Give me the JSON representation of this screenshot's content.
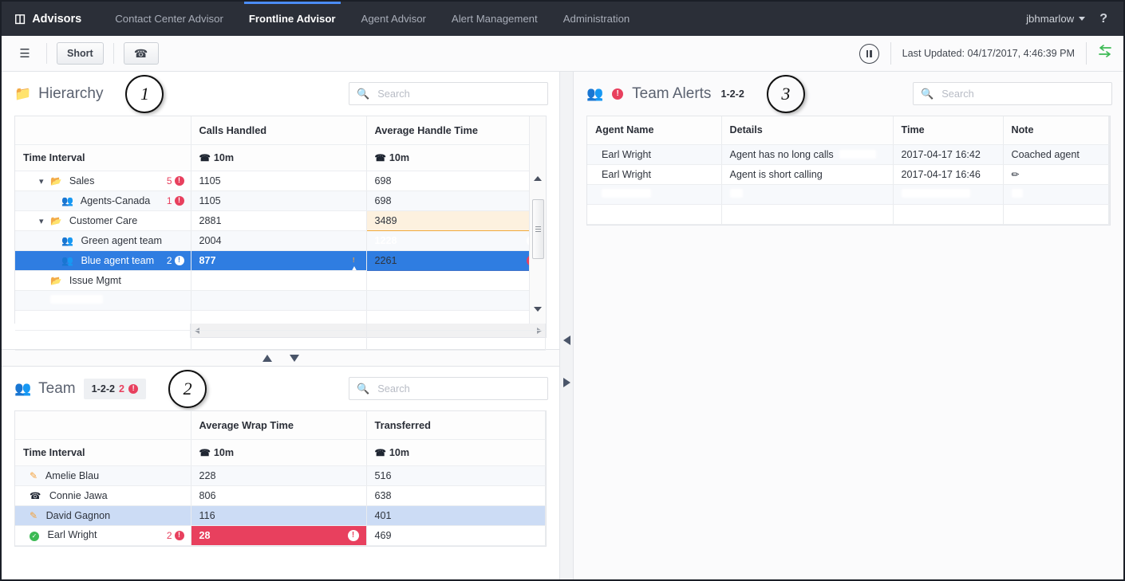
{
  "topnav": {
    "brand": "Advisors",
    "brand_icon": "stack-icon",
    "tabs": [
      {
        "label": "Contact Center Advisor",
        "active": false
      },
      {
        "label": "Frontline Advisor",
        "active": true
      },
      {
        "label": "Agent Advisor",
        "active": false
      },
      {
        "label": "Alert Management",
        "active": false
      },
      {
        "label": "Administration",
        "active": false
      }
    ],
    "user": "jbhmarlow",
    "help": "?"
  },
  "toolbar": {
    "columns_icon": "columns-icon",
    "short_label": "Short",
    "phone_icon": "phone-icon",
    "pause_icon": "pause-icon",
    "last_updated": "Last Updated: 04/17/2017, 4:46:39 PM",
    "sync_icon": "sync-arrows-icon"
  },
  "hierarchy": {
    "title": "Hierarchy",
    "icon": "folder-icon",
    "callout": "1",
    "search_placeholder": "Search",
    "search_value": "",
    "columns": [
      "",
      "Calls Handled",
      "Average Handle Time"
    ],
    "subheaders": [
      "Time Interval",
      "10m",
      "10m"
    ],
    "rows": [
      {
        "name": "Sales",
        "indent": 1,
        "icon": "folder-open-icon",
        "expander": "chevron-down-icon",
        "badge_count": "5",
        "badge_type": "critical",
        "calls_handled": "1105",
        "calls_state": "normal",
        "aht": "698",
        "aht_state": "normal",
        "row_state": "normal"
      },
      {
        "name": "Agents-Canada",
        "indent": 2,
        "icon": "agents-icon",
        "expander": "",
        "badge_count": "1",
        "badge_type": "critical",
        "calls_handled": "1105",
        "calls_state": "normal",
        "aht": "698",
        "aht_state": "normal",
        "row_state": "lite"
      },
      {
        "name": "Customer Care",
        "indent": 1,
        "icon": "folder-open-icon",
        "expander": "chevron-down-icon",
        "badge_count": "",
        "badge_type": "",
        "calls_handled": "2881",
        "calls_state": "normal",
        "aht": "3489",
        "aht_state": "warn",
        "row_state": "normal"
      },
      {
        "name": "Green agent team",
        "indent": 2,
        "icon": "agents-icon",
        "expander": "",
        "badge_count": "",
        "badge_type": "",
        "calls_handled": "2004",
        "calls_state": "normal",
        "aht": "1228",
        "aht_state": "critical",
        "row_state": "lite"
      },
      {
        "name": "Blue agent team",
        "indent": 2,
        "icon": "agents-icon",
        "expander": "",
        "badge_count": "2",
        "badge_type": "selected",
        "calls_handled": "877",
        "calls_state": "orange",
        "aht": "2261",
        "aht_state": "critical-lite",
        "row_state": "selected"
      },
      {
        "name": "Issue Mgmt",
        "indent": 1,
        "icon": "folder-open-icon",
        "expander": "",
        "badge_count": "",
        "badge_type": "",
        "calls_handled": "",
        "calls_state": "normal",
        "aht": "",
        "aht_state": "normal",
        "row_state": "normal"
      },
      {
        "name": "",
        "indent": 1,
        "icon": "",
        "expander": "",
        "badge_count": "",
        "badge_type": "",
        "calls_handled": "",
        "calls_state": "normal",
        "aht": "",
        "aht_state": "normal",
        "row_state": "blank-lite"
      },
      {
        "name": "",
        "indent": 1,
        "icon": "",
        "expander": "",
        "badge_count": "",
        "badge_type": "",
        "calls_handled": "",
        "calls_state": "normal",
        "aht": "",
        "aht_state": "normal",
        "row_state": "blank"
      }
    ]
  },
  "team": {
    "title": "Team",
    "icon": "team-icon",
    "callout": "2",
    "chip_label": "1-2-2",
    "chip_count": "2",
    "search_placeholder": "Search",
    "search_value": "",
    "columns": [
      "",
      "Average Wrap Time",
      "Transferred"
    ],
    "subheaders": [
      "Time Interval",
      "10m",
      "10m"
    ],
    "rows": [
      {
        "name": "Amelie Blau",
        "status_icon": "note-icon",
        "badge_count": "",
        "wrap_time": "228",
        "wrap_state": "normal",
        "transferred": "516",
        "row_state": "lite"
      },
      {
        "name": "Connie Jawa",
        "status_icon": "phone-icon",
        "badge_count": "",
        "wrap_time": "806",
        "wrap_state": "normal",
        "transferred": "638",
        "row_state": "normal"
      },
      {
        "name": "David Gagnon",
        "status_icon": "note-icon",
        "badge_count": "",
        "wrap_time": "116",
        "wrap_state": "normal",
        "transferred": "401",
        "row_state": "highlight"
      },
      {
        "name": "Earl Wright",
        "status_icon": "check-circle-icon",
        "badge_count": "2",
        "wrap_time": "28",
        "wrap_state": "critical",
        "transferred": "469",
        "row_state": "normal"
      }
    ]
  },
  "team_alerts": {
    "title": "Team Alerts",
    "icon": "team-icon",
    "alert_dot": "!",
    "chip_label": "1-2-2",
    "callout": "3",
    "search_placeholder": "Search",
    "search_value": "",
    "columns": [
      "Agent Name",
      "Details",
      "Time",
      "Note"
    ],
    "rows": [
      {
        "agent_name": "Earl Wright",
        "details": "Agent has no long calls",
        "time": "2017-04-17 16:42",
        "note": "Coached agent",
        "note_icon": "",
        "row_state": "lite"
      },
      {
        "agent_name": "Earl Wright",
        "details": "Agent is short calling",
        "time": "2017-04-17 16:46",
        "note": "",
        "note_icon": "pencil-icon",
        "row_state": "normal"
      },
      {
        "agent_name": "",
        "details": "",
        "time": "",
        "note": "",
        "note_icon": "",
        "row_state": "blank-lite"
      },
      {
        "agent_name": "",
        "details": "",
        "time": "",
        "note": "",
        "note_icon": "",
        "row_state": "blank"
      }
    ]
  },
  "colors": {
    "nav_bg": "#2b2f38",
    "accent_blue": "#4b8df8",
    "selected_row": "#2f7de1",
    "critical_red": "#e8405e",
    "warn_orange": "#f0a93c",
    "cell_orange": "#f4a23c",
    "ok_green": "#3cba54",
    "highlight_blue": "#ccdcf5"
  }
}
